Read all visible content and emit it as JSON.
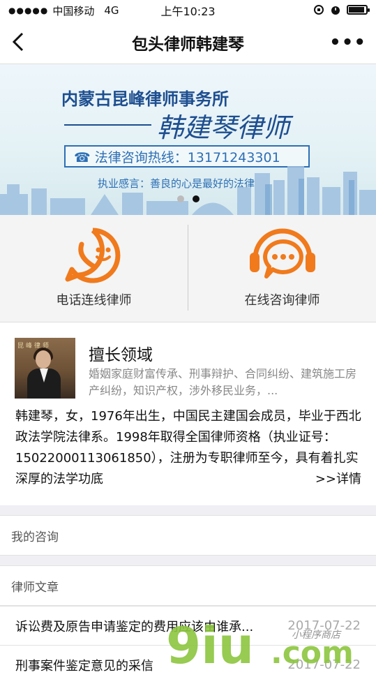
{
  "status_bar": {
    "signal_dots": "●●●●●",
    "carrier": "中国移动",
    "network": "4G",
    "time": "上午10:23"
  },
  "nav": {
    "title": "包头律师韩建琴",
    "more": "•••"
  },
  "banner": {
    "firm": "内蒙古昆峰律师事务所",
    "lawyer_name": "韩建琴律师",
    "hotline": "☎ 法律咨询热线：13171243301",
    "motto": "执业感言：善良的心是最好的法律",
    "slide_count": 2,
    "active_slide": 2
  },
  "services": [
    {
      "label": "电话连线律师",
      "icon": "phone-smile-icon",
      "color": "#f07a1c"
    },
    {
      "label": "在线咨询律师",
      "icon": "headset-chat-icon",
      "color": "#f07a1c"
    }
  ],
  "profile": {
    "avatar_sign": "昆峰律师",
    "expertise_title": "擅长领域",
    "expertise_desc": "婚姻家庭财富传承、刑事辩护、合同纠纷、建筑施工房产纠纷，知识产权，涉外移民业务，...",
    "bio": "韩建琴，女，1976年出生，中国民主建国会成员，毕业于西北政法学院法律系。1998年取得全国律师资格（执业证号：15022000113061850），注册为专职律师至今，具有着扎实深厚的法学功底",
    "more_link": ">>详情"
  },
  "sections": {
    "my_consult": "我的咨询",
    "articles_header": "律师文章"
  },
  "articles": [
    {
      "title": "诉讼费及原告申请鉴定的费用应该由谁承...",
      "date": "2017-07-22"
    },
    {
      "title": "刑事案件鉴定意见的采信",
      "date": "2017-07-22"
    }
  ],
  "watermark": {
    "text": "9iu.com",
    "tagline": "小程序商店"
  },
  "colors": {
    "accent_orange": "#f07a1c",
    "banner_blue": "#1d4e8f",
    "watermark_green": "#8cc63f"
  }
}
